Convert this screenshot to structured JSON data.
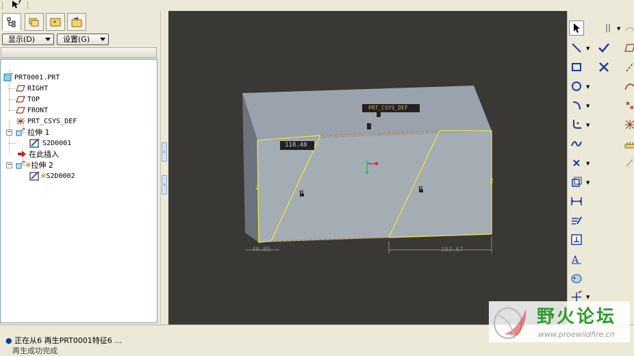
{
  "toolbar": {
    "pointer_tool": "?"
  },
  "left_panel": {
    "show_button": "显示(D)",
    "settings_button": "设置(G)",
    "tree": [
      {
        "label": "PRT0001.PRT",
        "icon": "part-icon"
      },
      {
        "label": "RIGHT",
        "icon": "datum-plane-icon"
      },
      {
        "label": "TOP",
        "icon": "datum-plane-icon"
      },
      {
        "label": "FRONT",
        "icon": "datum-plane-icon"
      },
      {
        "label": "PRT_CSYS_DEF",
        "icon": "csys-icon"
      },
      {
        "label": "拉伸 1",
        "icon": "extrude-icon"
      },
      {
        "label": "S2D0001",
        "icon": "sketch-icon"
      },
      {
        "label": "在此插入",
        "icon": "insert-here-arrow-icon"
      },
      {
        "label": "拉伸 2",
        "icon": "extrude-icon",
        "prefix": "※"
      },
      {
        "label": "S2D0002",
        "icon": "sketch-icon",
        "prefix": "※"
      }
    ]
  },
  "viewport": {
    "csys_label": "PRT_CSYS_DEF",
    "dim_top": "118.40",
    "dim_bottom_left": "40.85",
    "dim_bottom_right": "192.67",
    "dim_left_side": "2",
    "dim_right_side": "2",
    "constraint_label": "H",
    "small_marks": "ε"
  },
  "status": {
    "message1": "正在从6 再生PRT0001特征6 ...",
    "message2": "再生成功完成"
  },
  "watermark": {
    "title": "野火论坛",
    "url": "www.proewildfire.cn"
  },
  "colors": {
    "viewport_bg": "#3a3835",
    "model_face": "#a0a8b0",
    "sketch_yellow": "#e8e840",
    "dim_orange": "#d08030",
    "watermark_green": "#2e9a2e"
  }
}
